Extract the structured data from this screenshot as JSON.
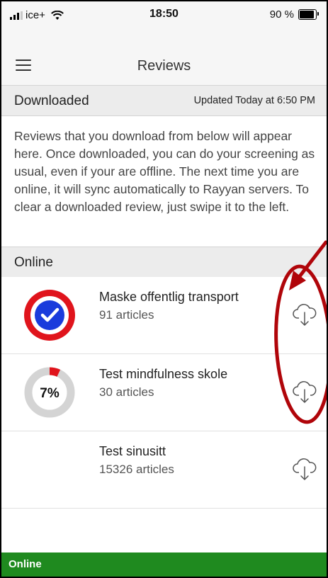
{
  "status_bar": {
    "carrier": "ice+",
    "time": "18:50",
    "battery": "90 %",
    "battery_level": 0.9
  },
  "nav": {
    "title": "Reviews",
    "menu_icon": "hamburger-icon"
  },
  "downloaded": {
    "title": "Downloaded",
    "updated": "Updated Today at 6:50 PM",
    "info": "Reviews that you download from below will appear here. Once downloaded, you can do your screening as usual, even if your are offline. The next time you are online, it will sync automatically to Rayyan servers. To clear a downloaded review, just swipe it to the left."
  },
  "online": {
    "title": "Online",
    "reviews": [
      {
        "title": "Maske offentlig transport",
        "count": "91 articles",
        "progress_label": "",
        "progress": 1.0,
        "status": "complete",
        "icon": "cloud-download-icon"
      },
      {
        "title": "Test mindfulness skole",
        "count": "30 articles",
        "progress_label": "7%",
        "progress": 0.07,
        "status": "in-progress",
        "icon": "cloud-download-icon"
      },
      {
        "title": "Test sinusitt",
        "count": "15326 articles",
        "progress_label": "",
        "progress": 0,
        "status": "none",
        "icon": "cloud-download-icon"
      }
    ]
  },
  "bottom_bar": {
    "text": "Online",
    "color": "#1f8a1f"
  },
  "colors": {
    "accent_red": "#e0141c",
    "check_blue": "#1a3bdc",
    "annotation_red": "#b0050a"
  }
}
